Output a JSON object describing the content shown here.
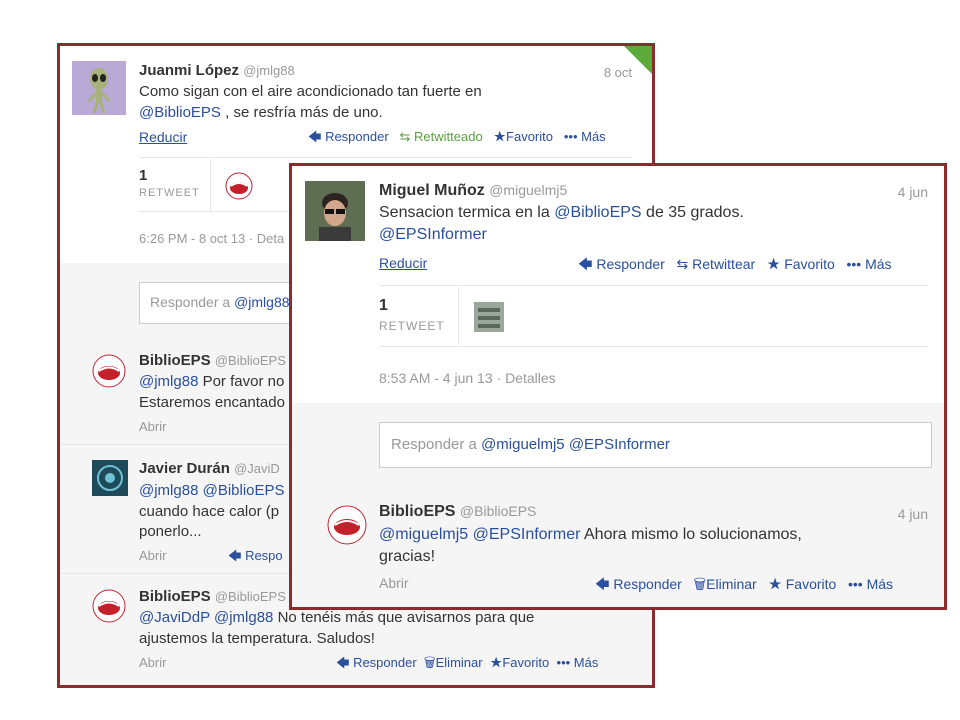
{
  "back": {
    "main": {
      "name": "Juanmi López",
      "handle": "@jmlg88",
      "date": "8 oct",
      "text1": "Como sigan con el aire acondicionado tan fuerte en",
      "mention": "@BiblioEPS",
      "text2": " , se resfría más de uno.",
      "reduce": "Reducir",
      "reply": "Responder",
      "retweeted": "Retwitteado",
      "favorite": "Favorito",
      "more": "Más",
      "rt_count": "1",
      "rt_label": "RETWEET",
      "meta": "6:26 PM - 8 oct 13 · Deta"
    },
    "reply_box": {
      "prefix": "Responder a ",
      "mention": "@jmlg88"
    },
    "replies": [
      {
        "name": "BiblioEPS",
        "handle": "@BiblioEPS",
        "mention": "@jmlg88",
        "text1": " Por favor no",
        "line2": "Estaremos encantado",
        "open": "Abrir"
      },
      {
        "name": "Javier Durán",
        "handle": "@JaviD",
        "m1": "@jmlg88",
        "m2": "@BiblioEPS",
        "line2": "cuando hace calor (p",
        "line3": "ponerlo...",
        "open": "Abrir",
        "reply": "Respo"
      },
      {
        "name": "BiblioEPS",
        "handle": "@BiblioEPS",
        "m1": "@JaviDdP",
        "m2": "@jmlg88",
        "text1": " No tenéis más que avisarnos para que",
        "line2": "ajustemos la temperatura. Saludos!",
        "open": "Abrir",
        "reply": "Responder",
        "delete": "Eliminar",
        "favorite": "Favorito",
        "more": "Más"
      }
    ]
  },
  "front": {
    "main": {
      "name": "Miguel Muñoz",
      "handle": "@miguelmj5",
      "date": "4 jun",
      "text1": "Sensacion termica en la ",
      "mention1": "@BiblioEPS",
      "text2": " de 35 grados.",
      "mention2": "@EPSInformer",
      "reduce": "Reducir",
      "reply": "Responder",
      "retweet": "Retwittear",
      "favorite": "Favorito",
      "more": "Más",
      "rt_count": "1",
      "rt_label": "RETWEET",
      "meta": "8:53 AM - 4 jun 13 · Detalles"
    },
    "reply_box": {
      "prefix": "Responder a ",
      "mention1": "@miguelmj5",
      "mention2": "@EPSInformer"
    },
    "reply": {
      "name": "BiblioEPS",
      "handle": "@BiblioEPS",
      "date": "4 jun",
      "m1": "@miguelmj5",
      "m2": "@EPSInformer",
      "text1": " Ahora mismo lo solucionamos,",
      "line2": "gracias!",
      "open": "Abrir",
      "reply": "Responder",
      "delete": "Eliminar",
      "favorite": "Favorito",
      "more": "Más"
    }
  },
  "colors": {
    "frame": "#8c2b2b",
    "link": "#2a4f9c",
    "retweeted": "#5c9e3f"
  },
  "icons": [
    "reply-arrow-icon",
    "retweet-icon",
    "star-icon",
    "dots-icon",
    "trash-icon",
    "alien-avatar-icon",
    "biblio-logo-icon"
  ]
}
